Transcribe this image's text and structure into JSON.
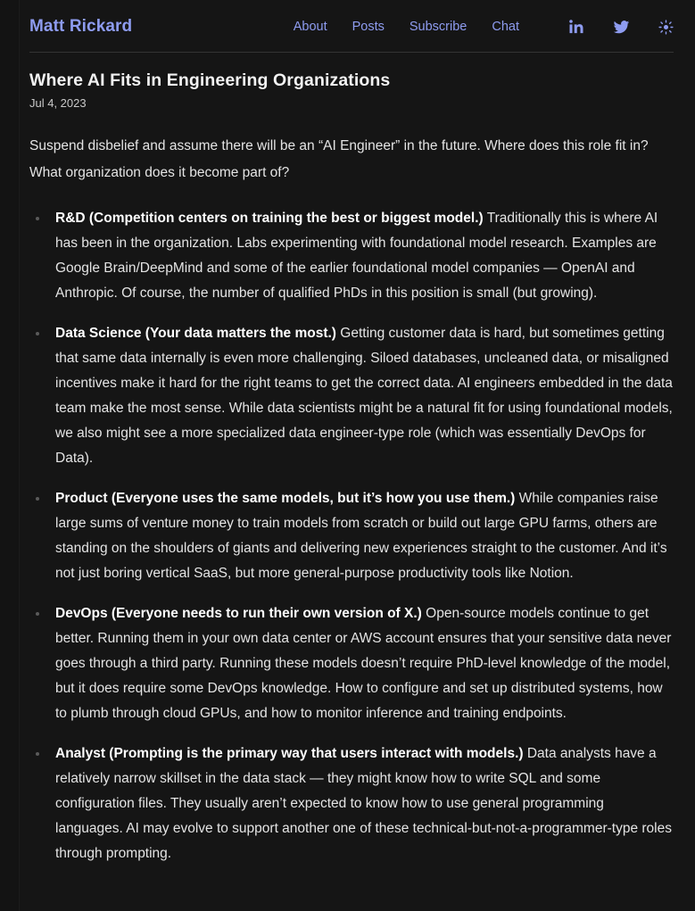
{
  "site": {
    "brand": "Matt Rickard",
    "nav_links": [
      {
        "label": "About"
      },
      {
        "label": "Posts"
      },
      {
        "label": "Subscribe"
      },
      {
        "label": "Chat"
      }
    ],
    "icons": [
      {
        "name": "linkedin-icon",
        "label": "LinkedIn"
      },
      {
        "name": "twitter-icon",
        "label": "Twitter"
      },
      {
        "name": "sun-icon",
        "label": "Toggle light mode"
      }
    ],
    "colors": {
      "background": "#151515",
      "accent": "#8e9cf0",
      "body_text": "#e4e4e4",
      "heading_text": "#f2f2f2",
      "rule": "#333333",
      "bullet": "#5a5a5a"
    }
  },
  "post": {
    "title": "Where AI Fits in Engineering Organizations",
    "date": "Jul 4, 2023",
    "lede": "Suspend disbelief and assume there will be an “AI Engineer” in the future. Where does this role fit in? What organization does it become part of?",
    "bullets": [
      {
        "lead_in": "R&D (Competition centers on training the best or biggest model.)",
        "body": " Traditionally this is where AI has been in the organization. Labs experimenting with foundational model research. Examples are Google Brain/DeepMind and some of the earlier foundational model companies — OpenAI and Anthropic. Of course, the number of qualified PhDs in this position is small (but growing)."
      },
      {
        "lead_in": "Data Science (Your data matters the most.)",
        "body": " Getting customer data is hard, but sometimes getting that same data internally is even more challenging. Siloed databases, uncleaned data, or misaligned incentives make it hard for the right teams to get the correct data. AI engineers embedded in the data team make the most sense. While data scientists might be a natural fit for using foundational models, we also might see a more specialized data engineer-type role (which was essentially DevOps for Data)."
      },
      {
        "lead_in": "Product (Everyone uses the same models, but it’s how you use them.)",
        "body": " While companies raise large sums of venture money to train models from scratch or build out large GPU farms, others are standing on the shoulders of giants and delivering new experiences straight to the customer. And it’s not just boring vertical SaaS, but more general-purpose productivity tools like Notion."
      },
      {
        "lead_in": "DevOps (Everyone needs to run their own version of X.)",
        "body": " Open-source models continue to get better. Running them in your own data center or AWS account ensures that your sensitive data never goes through a third party. Running these models doesn’t require PhD-level knowledge of the model, but it does require some DevOps knowledge. How to configure and set up distributed systems, how to plumb through cloud GPUs, and how to monitor inference and training endpoints."
      },
      {
        "lead_in": "Analyst (Prompting is the primary way that users interact with models.)",
        "body": " Data analysts have a relatively narrow skillset in the data stack — they might know how to write SQL and some configuration files. They usually aren’t expected to know how to use general programming languages. AI may evolve to support another one of these technical-but-not-a-programmer-type roles through prompting."
      }
    ]
  }
}
